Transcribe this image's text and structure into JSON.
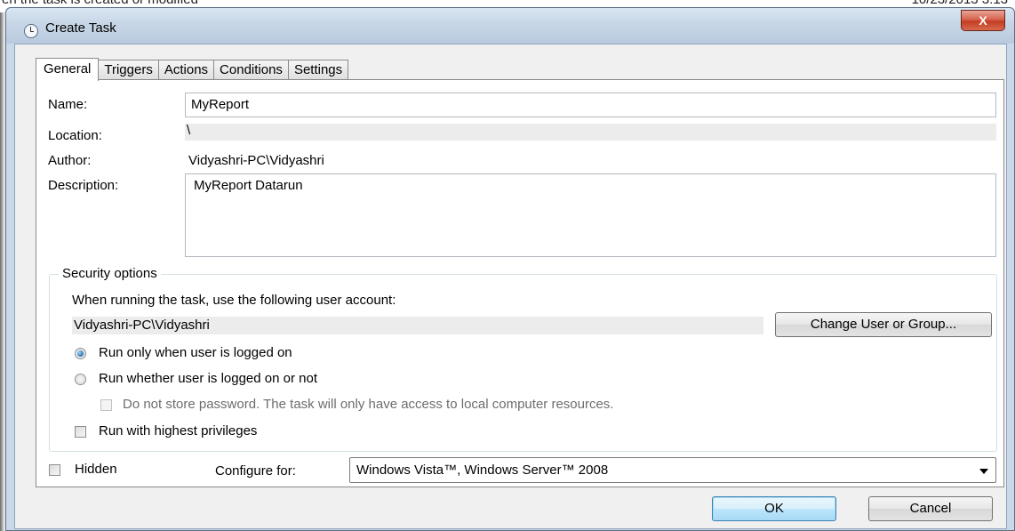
{
  "background": {
    "top_left_text": "en the task is created or modified",
    "top_right_text": "10/23/2013 3:13"
  },
  "window": {
    "title": "Create Task",
    "close_glyph": "X"
  },
  "tabs": [
    {
      "label": "General",
      "active": true
    },
    {
      "label": "Triggers",
      "active": false
    },
    {
      "label": "Actions",
      "active": false
    },
    {
      "label": "Conditions",
      "active": false
    },
    {
      "label": "Settings",
      "active": false
    }
  ],
  "general": {
    "name_label": "Name:",
    "name_value": "MyReport",
    "location_label": "Location:",
    "location_value": "\\",
    "author_label": "Author:",
    "author_value": "Vidyashri-PC\\Vidyashri",
    "description_label": "Description:",
    "description_value": "MyReport Datarun"
  },
  "security": {
    "legend": "Security options",
    "account_prompt": "When running the task, use the following user account:",
    "account_value": "Vidyashri-PC\\Vidyashri",
    "change_button": "Change User or Group...",
    "radio_logged_on": "Run only when user is logged on",
    "radio_logged_on_checked": true,
    "radio_whether": "Run whether user is logged on or not",
    "radio_whether_checked": false,
    "no_store_password": "Do not store password.  The task will only have access to local computer resources.",
    "highest_privileges": "Run with highest privileges"
  },
  "footer": {
    "hidden_label": "Hidden",
    "configure_label": "Configure for:",
    "configure_value": "Windows Vista™, Windows Server™ 2008"
  },
  "buttons": {
    "ok": "OK",
    "cancel": "Cancel"
  },
  "colors": {
    "frame": "#c9d9ea",
    "close": "#c43d22",
    "client": "#f0f0f0",
    "radio_accent": "#1f6fb8"
  },
  "icons": {
    "title": "clock-icon",
    "close": "close-icon",
    "dropdown": "chevron-down-icon"
  }
}
